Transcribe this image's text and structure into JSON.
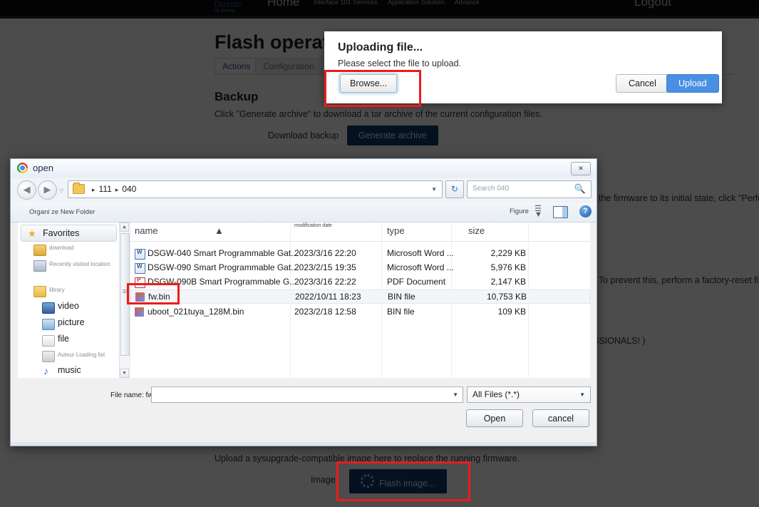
{
  "topnav": {
    "brand": "Dusun",
    "brand_sub": "Le Sheng",
    "home": "Home",
    "items": [
      "Interface 101 Services,",
      "Application Solution,",
      "Advance"
    ],
    "logout": "Logout"
  },
  "page": {
    "title": "Flash operations",
    "tabs": [
      {
        "label": "Actions",
        "active": true
      },
      {
        "label": "Configuration",
        "active": false
      }
    ],
    "backup_heading": "Backup",
    "backup_text": "Click \"Generate archive\" to download a tar archive of the current configuration files.",
    "download_backup_label": "Download backup",
    "generate_archive_label": "Generate archive",
    "reset_text_fragment": "the firmware to its initial state, click \"Perfor",
    "prevent_text_fragment": "To prevent this, perform a factory-reset firs",
    "professionals_fragment": "SSIONALS! )",
    "flash_text": "Upload a sysupgrade-compatible image here to replace the running firmware.",
    "image_label": "Image",
    "flash_image_label": "Flash image..."
  },
  "upload_modal": {
    "title": "Uploading file...",
    "subtitle": "Please select the file to upload.",
    "browse_label": "Browse...",
    "cancel_label": "Cancel",
    "upload_label": "Upload"
  },
  "file_dialog": {
    "title": "open",
    "close_label": "✕",
    "nav": {
      "back": "◀",
      "forward": "▶",
      "dropdown": "▽",
      "refresh": "↻",
      "breadcrumbs": [
        "111",
        "040"
      ],
      "crumb_sep": "▸",
      "address_caret": "▼"
    },
    "search": {
      "placeholder": "Search 040",
      "icon": "search-icon"
    },
    "toolbar": {
      "organize": "Organi ze New Folder",
      "figure": "Figure",
      "help": "?"
    },
    "sidebar": {
      "favorites": "Favorites",
      "items": [
        {
          "label": "download",
          "icon": "download-folder-icon",
          "faint": true
        },
        {
          "label": "Recently visited location",
          "icon": "recent-icon",
          "faint": true
        },
        {
          "label": "library",
          "icon": "library-icon",
          "faint": true
        },
        {
          "label": "video",
          "icon": "video-icon",
          "faint": false
        },
        {
          "label": "picture",
          "icon": "picture-icon",
          "faint": false
        },
        {
          "label": "file",
          "icon": "file-icon",
          "faint": false
        },
        {
          "label": "Auteur Loading list",
          "icon": "documents-icon",
          "faint": true
        },
        {
          "label": "music",
          "icon": "music-icon",
          "faint": false
        }
      ]
    },
    "columns": [
      "name",
      "modification date",
      "type",
      "size"
    ],
    "files": [
      {
        "name": "DSGW-040 Smart Programmable Gat...",
        "date": "2023/3/16 22:20",
        "type": "Microsoft Word ...",
        "size": "2,229 KB",
        "icon": "word-file-icon",
        "selected": false
      },
      {
        "name": "DSGW-090 Smart Programmable Gat...",
        "date": "2023/2/15 19:35",
        "type": "Microsoft Word ...",
        "size": "5,976 KB",
        "icon": "word-file-icon",
        "selected": false
      },
      {
        "name": "DSGW-090B  Smart Programmable G...",
        "date": "2023/3/16 22:22",
        "type": "PDF Document",
        "size": "2,147 KB",
        "icon": "pdf-file-icon",
        "selected": false
      },
      {
        "name": "fw.bin",
        "date": "2022/10/11 18:23",
        "type": "BIN file",
        "size": "10,753 KB",
        "icon": "bin-file-icon",
        "selected": true
      },
      {
        "name": "uboot_021tuya_128M.bin",
        "date": "2023/2/18 12:58",
        "type": "BIN file",
        "size": "109 KB",
        "icon": "bin-file-icon",
        "selected": false
      }
    ],
    "footer": {
      "filename_label": "File name:",
      "filename_value": "fw.bin",
      "filter_value": "All Files (*.*)",
      "open_label": "Open",
      "cancel_label": "cancel",
      "caret": "▼"
    }
  },
  "colors": {
    "accent_blue": "#4a90e2",
    "dark_blue": "#123a6b",
    "annotation_red": "#ee1b1b",
    "link_blue": "#2a4b8d"
  }
}
